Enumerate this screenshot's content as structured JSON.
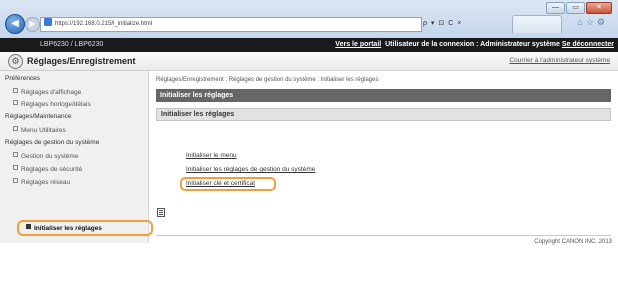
{
  "browser": {
    "url": "https://192.168.0.215/l_initialize.html",
    "address_controls": "ρ ▾ ⊡ C ×",
    "window_buttons": [
      "—",
      "▭",
      "✕"
    ]
  },
  "topbar": {
    "model": "LBP6230 / LBP6230",
    "portal_link": "Vers le portail",
    "login_info": "Utilisateur de la connexion : Administrateur système",
    "logout_link": "Se déconnecter"
  },
  "header": {
    "title": "Réglages/Enregistrement",
    "admin_link": "Courrier à l'administrateur système"
  },
  "sidebar": {
    "categories": [
      {
        "label": "Préférences",
        "items": [
          "Réglages d'affichage",
          "Réglages horloge/délais"
        ]
      },
      {
        "label": "Réglages/Maintenance",
        "items": [
          "Menu Utilitaires"
        ]
      },
      {
        "label": "Réglages de gestion du système",
        "items": [
          "Gestion du système",
          "Réglages de sécurité",
          "Réglages réseau",
          "Initialiser les réglages"
        ]
      }
    ]
  },
  "main": {
    "breadcrumb": "Réglages/Enregistrement : Réglages de gestion du système : Initialiser les réglages",
    "section_title": "Initialiser les réglages",
    "subsection_title": "Initialiser les réglages",
    "links": [
      "Initialiser le menu",
      "Initialiser les réglages de gestion du système",
      "Initialiser clé et certificat"
    ]
  },
  "footer": {
    "copyright": "Copyright CANON INC. 2013"
  },
  "colors": {
    "highlight": "#f0a23a",
    "topbar": "#1a1a1a",
    "section_bar": "#666666"
  }
}
